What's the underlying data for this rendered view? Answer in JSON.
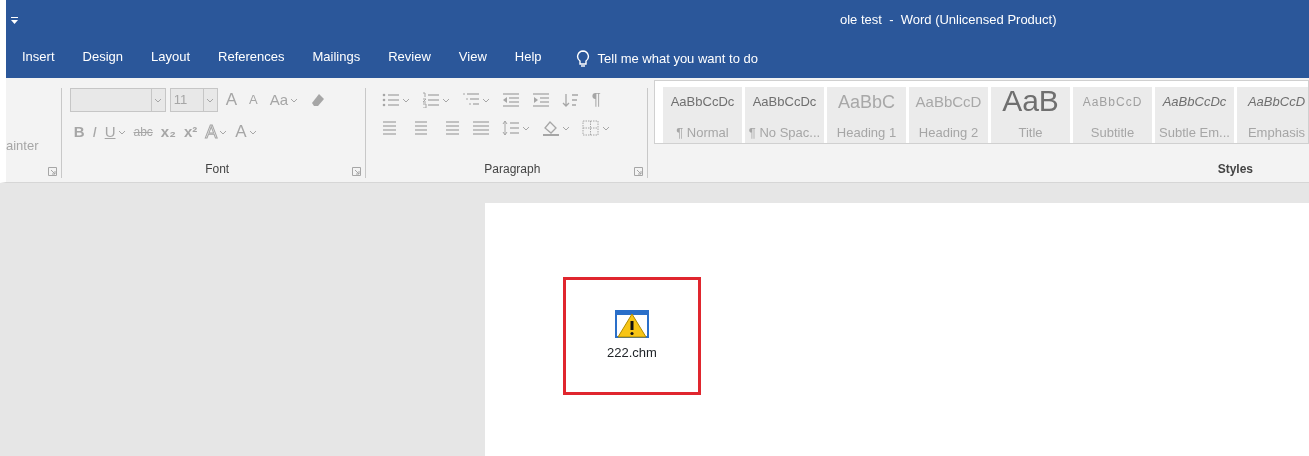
{
  "window": {
    "title": "ole test  -  Word (Unlicensed Product)"
  },
  "tabs": [
    {
      "label": "Insert",
      "selected": false
    },
    {
      "label": "Design",
      "selected": false
    },
    {
      "label": "Layout",
      "selected": false
    },
    {
      "label": "References",
      "selected": false
    },
    {
      "label": "Mailings",
      "selected": false
    },
    {
      "label": "Review",
      "selected": false
    },
    {
      "label": "View",
      "selected": false
    },
    {
      "label": "Help",
      "selected": false
    }
  ],
  "tell_me": {
    "text": "Tell me what you want to do"
  },
  "ribbon": {
    "disabled": true,
    "clipboard": {
      "fragment": "ainter"
    },
    "font": {
      "label": "Font",
      "size": "11",
      "row1": [
        {
          "kind": "grow",
          "text": "A"
        },
        {
          "kind": "shrink",
          "text": "A"
        },
        {
          "kind": "case",
          "text": "Aa",
          "dropdown": true
        },
        {
          "kind": "clear"
        }
      ],
      "row2": [
        {
          "kind": "bold",
          "text": "B"
        },
        {
          "kind": "italic",
          "text": "I"
        },
        {
          "kind": "underline",
          "text": "U",
          "dropdown": true
        },
        {
          "kind": "strike",
          "text": "abc"
        },
        {
          "kind": "sub",
          "text": "x₂"
        },
        {
          "kind": "sup",
          "text": "x²"
        },
        {
          "kind": "effects",
          "text": "A",
          "dropdown": true
        },
        {
          "kind": "color",
          "text": "A",
          "dropdown": true
        }
      ]
    },
    "paragraph": {
      "label": "Paragraph",
      "pilcrow": "¶"
    },
    "styles": {
      "label": "Styles",
      "items": [
        {
          "preview": "AaBbCcDc",
          "name": "¶ Normal",
          "kind": "normal"
        },
        {
          "preview": "AaBbCcDc",
          "name": "¶ No Spac...",
          "kind": "normal"
        },
        {
          "preview": "AaBbC",
          "name": "Heading 1",
          "kind": "heading1"
        },
        {
          "preview": "AaBbCcD",
          "name": "Heading 2",
          "kind": "heading2"
        },
        {
          "preview": "AaB",
          "name": "Title",
          "kind": "title"
        },
        {
          "preview": "AaBbCcD",
          "name": "Subtitle",
          "kind": "subtitle"
        },
        {
          "preview": "AaBbCcDc",
          "name": "Subtle Em...",
          "kind": "italic"
        },
        {
          "preview": "AaBbCcD",
          "name": "Emphasis",
          "kind": "italic"
        }
      ]
    }
  },
  "document": {
    "object": {
      "label": "222.chm",
      "highlighted": true
    }
  }
}
